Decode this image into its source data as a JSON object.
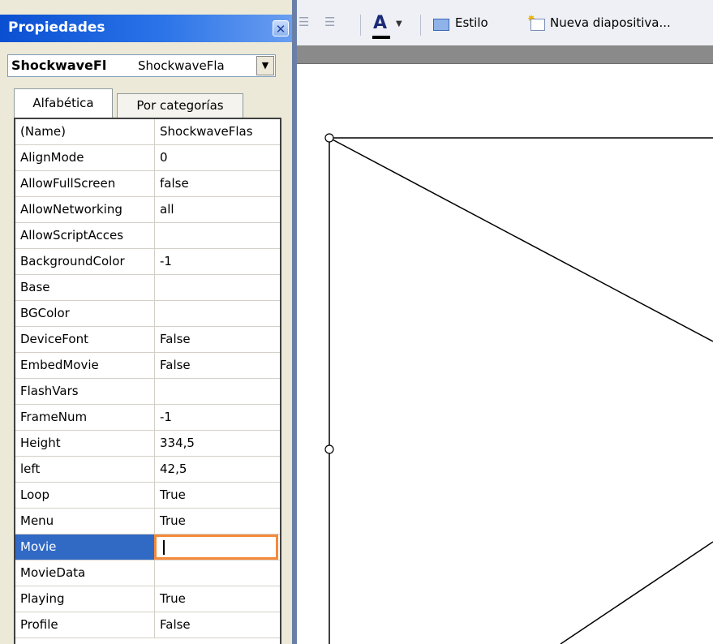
{
  "panel": {
    "title": "Propiedades",
    "close_glyph": "✕",
    "object_name": "ShockwaveFl",
    "object_type": "ShockwaveFla",
    "dropdown_glyph": "▼",
    "tabs": [
      {
        "label": "Alfabética",
        "active": true
      },
      {
        "label": "Por categorías",
        "active": false
      }
    ],
    "rows": [
      {
        "name": "(Name)",
        "value": "ShockwaveFlas"
      },
      {
        "name": "AlignMode",
        "value": "0"
      },
      {
        "name": "AllowFullScreen",
        "value": "false"
      },
      {
        "name": "AllowNetworking",
        "value": "all"
      },
      {
        "name": "AllowScriptAcces",
        "value": ""
      },
      {
        "name": "BackgroundColor",
        "value": "-1"
      },
      {
        "name": "Base",
        "value": ""
      },
      {
        "name": "BGColor",
        "value": ""
      },
      {
        "name": "DeviceFont",
        "value": "False"
      },
      {
        "name": "EmbedMovie",
        "value": "False"
      },
      {
        "name": "FlashVars",
        "value": ""
      },
      {
        "name": "FrameNum",
        "value": "-1"
      },
      {
        "name": "Height",
        "value": "334,5"
      },
      {
        "name": "left",
        "value": "42,5"
      },
      {
        "name": "Loop",
        "value": "True"
      },
      {
        "name": "Menu",
        "value": "True"
      },
      {
        "name": "Movie",
        "value": "",
        "selected": true,
        "editing": true
      },
      {
        "name": "MovieData",
        "value": ""
      },
      {
        "name": "Playing",
        "value": "True"
      },
      {
        "name": "Profile",
        "value": "False"
      }
    ]
  },
  "toolbar": {
    "font_color_glyph": "A",
    "dropdown_glyph": "▼",
    "estilo_label": "Estilo",
    "nueva_label": "Nueva diapositiva..."
  },
  "icons": [
    "close-icon",
    "dropdown-arrow-icon",
    "decrease-indent-icon",
    "increase-indent-icon",
    "font-color-icon",
    "estilo-icon",
    "new-slide-icon",
    "resize-handle-icon"
  ],
  "colors": {
    "title_bar": "#0a4fd1",
    "selection": "#316ac5",
    "edit_highlight": "#f58a3b",
    "panel_bg": "#ece9d8"
  }
}
